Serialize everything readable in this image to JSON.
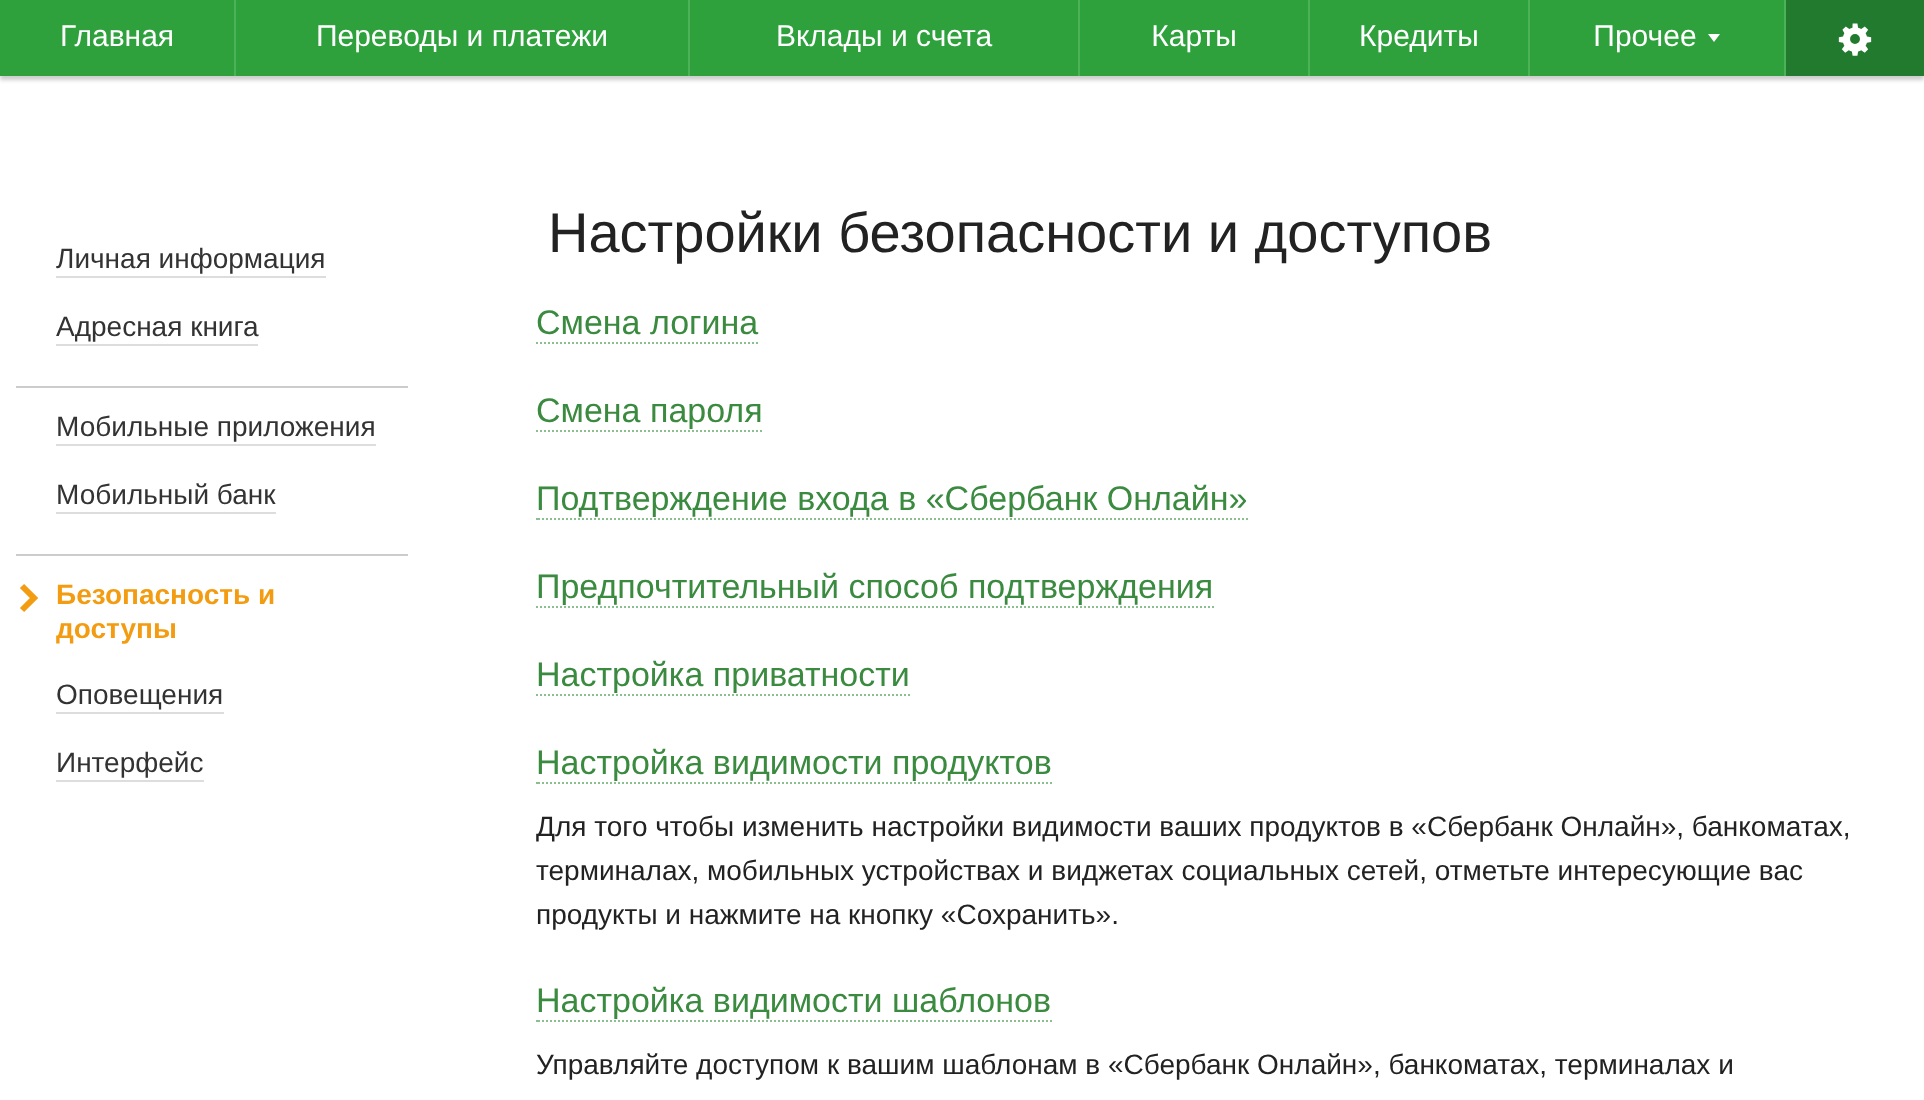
{
  "top_nav": {
    "items": [
      {
        "label": "Главная",
        "dropdown": false
      },
      {
        "label": "Переводы и платежи",
        "dropdown": false
      },
      {
        "label": "Вклады и счета",
        "dropdown": false
      },
      {
        "label": "Карты",
        "dropdown": false
      },
      {
        "label": "Кредиты",
        "dropdown": false
      },
      {
        "label": "Прочее",
        "dropdown": true
      }
    ]
  },
  "sidebar": {
    "groups": [
      {
        "items": [
          {
            "label": "Личная информация",
            "selected": false
          },
          {
            "label": "Адресная книга",
            "selected": false
          }
        ]
      },
      {
        "items": [
          {
            "label": "Мобильные приложения",
            "selected": false
          },
          {
            "label": "Мобильный банк",
            "selected": false
          }
        ]
      },
      {
        "items": [
          {
            "label": "Безопасность и доступы",
            "selected": true
          },
          {
            "label": "Оповещения",
            "selected": false
          },
          {
            "label": "Интерфейс",
            "selected": false
          }
        ]
      }
    ]
  },
  "page_title": "Настройки безопасности и доступов",
  "sections": [
    {
      "title": "Смена логина"
    },
    {
      "title": "Смена пароля"
    },
    {
      "title": "Подтверждение входа в «Сбербанк Онлайн»"
    },
    {
      "title": "Предпочтительный способ подтверждения"
    },
    {
      "title": "Настройка приватности"
    },
    {
      "title": "Настройка видимости продуктов",
      "description": "Для того чтобы изменить настройки видимости ваших продуктов в «Сбербанк Онлайн», банкоматах, терминалах, мобильных устройствах и виджетах социальных сетей, отметьте интересующие вас продукты и нажмите на кнопку «Сохранить»."
    },
    {
      "title": "Настройка видимости шаблонов",
      "description": "Управляйте доступом к вашим шаблонам в «Сбербанк Онлайн», банкоматах, терминалах и"
    }
  ]
}
